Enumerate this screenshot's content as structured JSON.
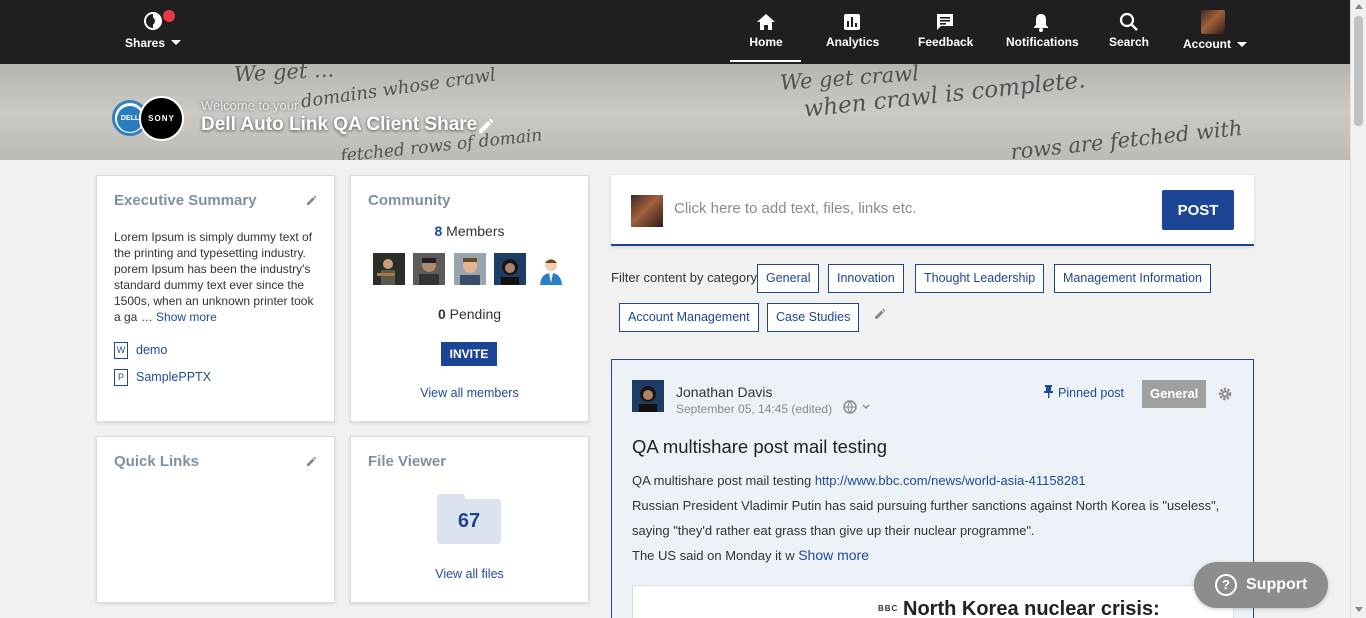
{
  "nav": {
    "shares_label": "Shares",
    "items": [
      {
        "label": "Home",
        "icon": "home-icon"
      },
      {
        "label": "Analytics",
        "icon": "analytics-icon"
      },
      {
        "label": "Feedback",
        "icon": "feedback-icon"
      },
      {
        "label": "Notifications",
        "icon": "bell-icon"
      },
      {
        "label": "Search",
        "icon": "search-icon"
      },
      {
        "label": "Account",
        "icon": "account-avatar"
      }
    ],
    "active": "Home"
  },
  "banner": {
    "welcome": "Welcome to your",
    "title": "Dell Auto Link QA Client Share",
    "logos": [
      "DELL",
      "SONY"
    ],
    "handwriting": [
      "We get ...",
      "domains whose crawl",
      "fetched rows of domain",
      "We get crawl",
      "when crawl is complete.",
      "rows are fetched with"
    ]
  },
  "executive_summary": {
    "title": "Executive Summary",
    "text": "Lorem Ipsum is simply dummy text of the printing and typesetting industry. porem Ipsum has been the industry's standard dummy text ever since the 1500s, when an unknown printer took a ga …",
    "show_more": "Show more",
    "files": [
      {
        "type": "W",
        "name": "demo"
      },
      {
        "type": "P",
        "name": "SamplePPTX"
      }
    ]
  },
  "community": {
    "title": "Community",
    "members_count": "8",
    "members_label": "Members",
    "pending_count": "0",
    "pending_label": "Pending",
    "invite_label": "INVITE",
    "view_all": "View all members"
  },
  "quick_links": {
    "title": "Quick Links"
  },
  "file_viewer": {
    "title": "File Viewer",
    "count": "67",
    "view_all": "View all files"
  },
  "composer": {
    "placeholder": "Click here to add text, files, links etc.",
    "post_label": "POST"
  },
  "filters": {
    "label": "Filter content by category",
    "categories": [
      "General",
      "Innovation",
      "Thought Leadership",
      "Management Information",
      "Account Management",
      "Case Studies"
    ]
  },
  "post": {
    "author": "Jonathan Davis",
    "date": "September 05, 14:45 (edited)",
    "pinned": "Pinned post",
    "category": "General",
    "title": "QA multishare post mail testing",
    "line1_text": "QA multishare post mail testing",
    "line1_link": "http://www.bbc.com/news/world-asia-41158281",
    "line2": "Russian President Vladimir Putin has said pursuing further sanctions against North Korea is \"useless\", saying \"they'd rather eat grass than give up their nuclear programme\".",
    "line3": "The US said on Monday it w",
    "show_more": "Show more",
    "preview_source": "BBC",
    "preview_title": "North Korea nuclear crisis:"
  },
  "support": {
    "label": "Support"
  },
  "colors": {
    "brand": "#1c4596",
    "topbar": "#1f1f1f",
    "notification_dot": "#e53945",
    "card_title": "#8190a1"
  }
}
